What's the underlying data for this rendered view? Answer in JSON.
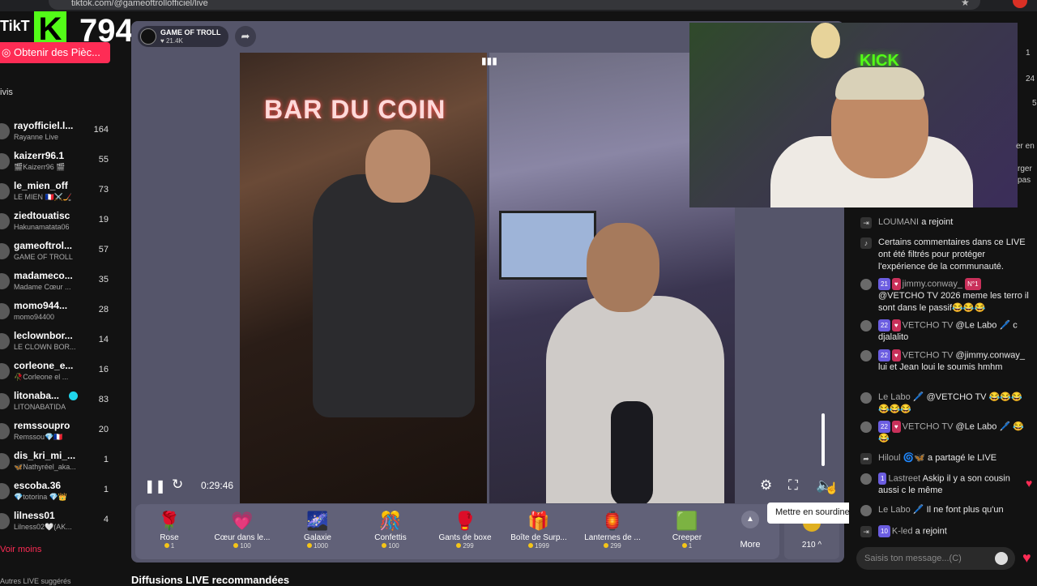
{
  "browser": {
    "url": "tiktok.com/@gameoftrollofficiel/live"
  },
  "overlay": {
    "tiktok_logo": "TikT",
    "viewer_count": "794"
  },
  "sidebar": {
    "coins_button": "Obtenir des Pièc...",
    "section_label": "ivis",
    "items": [
      {
        "name": "rayofficiel.l...",
        "sub": "Rayanne Live",
        "count": "164"
      },
      {
        "name": "kaizerr96.1",
        "sub": "🎬Kaizerr96 🎬",
        "count": "55"
      },
      {
        "name": "le_mien_off",
        "sub": "LE MIEN 🇫🇷⚔️🏒",
        "count": "73"
      },
      {
        "name": "ziedtouatisc",
        "sub": "Hakunamatata06",
        "count": "19"
      },
      {
        "name": "gameoftrol...",
        "sub": "GAME OF TROLL",
        "count": "57"
      },
      {
        "name": "madameco...",
        "sub": "Madame Cœur ...",
        "count": "35"
      },
      {
        "name": "momo944...",
        "sub": "momo94400",
        "count": "28"
      },
      {
        "name": "leclownbor...",
        "sub": "LE CLOWN BOR...",
        "count": "14"
      },
      {
        "name": "corleone_e...",
        "sub": "🥀Corleone el ...",
        "count": "16"
      },
      {
        "name": "litonaba...",
        "sub": "LITONABATIDA",
        "count": "83"
      },
      {
        "name": "remssoupro",
        "sub": "Remssou💎🇫🇷",
        "count": "20"
      },
      {
        "name": "dis_kri_mi_...",
        "sub": "🦋Nathyréel_aka...",
        "count": "1"
      },
      {
        "name": "escoba.36",
        "sub": "💎totorina 💎👑",
        "count": "1"
      },
      {
        "name": "lilness01",
        "sub": "Lilness02🤍(AK...",
        "count": "4"
      }
    ],
    "voir_moins": "Voir moins",
    "bottom_cut": "Autres LIVE suggérés"
  },
  "player": {
    "host_name": "GAME OF TROLL",
    "host_likes": "♥ 21.4K",
    "video_sign": "BAR DU COIN",
    "time": "0:29:46",
    "tooltip": "Mettre en sourdine (M)"
  },
  "gifts": [
    {
      "icon": "🌹",
      "name": "Rose",
      "price": "1"
    },
    {
      "icon": "💗",
      "name": "Cœur dans le...",
      "price": "100"
    },
    {
      "icon": "🌌",
      "name": "Galaxie",
      "price": "1000"
    },
    {
      "icon": "🎊",
      "name": "Confettis",
      "price": "100"
    },
    {
      "icon": "🥊",
      "name": "Gants de boxe",
      "price": "299"
    },
    {
      "icon": "🎁",
      "name": "Boîte de Surp...",
      "price": "1999"
    },
    {
      "icon": "🏮",
      "name": "Lanternes de ...",
      "price": "299"
    },
    {
      "icon": "🟩",
      "name": "Creeper",
      "price": "1"
    }
  ],
  "more_label": "More",
  "gift_counter": "210 ^",
  "recommended_title": "Diffusions LIVE recommandées",
  "webcam": {
    "sign": "KICK"
  },
  "edge": {
    "n1": "1",
    "n2": "24",
    "n3": "5",
    "t1": "er en",
    "t2": "rger",
    "t3": "pas"
  },
  "chat": [
    {
      "type": "system",
      "user": "LOUMANI",
      "text": "a rejoint"
    },
    {
      "type": "notice",
      "text": "Certains commentaires dans ce LIVE ont été filtrés pour protéger l'expérience de la communauté."
    },
    {
      "type": "msg",
      "level": "21",
      "fan": "♥",
      "user": "jimmy.conway_",
      "rank": "N°1",
      "text": "@VETCHO TV 2026 meme les terro il sont dans le passif😂😂😂"
    },
    {
      "type": "msg",
      "level": "22",
      "fan": "♥",
      "user": "VETCHO TV",
      "text": "@Le Labo 🖊️ c djalalito"
    },
    {
      "type": "msg",
      "level": "22",
      "fan": "♥",
      "user": "VETCHO TV",
      "text": "@jimmy.conway_ lui et Jean loui le soumis hmhm"
    },
    {
      "type": "msg",
      "level": "",
      "fan": "",
      "user": "Le Labo 🖊️",
      "text": "@VETCHO TV 😂😂😂😂😂😂"
    },
    {
      "type": "msg",
      "level": "22",
      "fan": "♥",
      "user": "VETCHO TV",
      "text": "@Le Labo 🖊️ 😂😂"
    },
    {
      "type": "share",
      "user": "Hiloul 🌀🦋",
      "text": "a partagé le LIVE"
    },
    {
      "type": "msg",
      "level": "1",
      "fan": "",
      "user": "Lastreet",
      "text": "Askip il y a son cousin aussi c le même"
    },
    {
      "type": "msg",
      "level": "",
      "fan": "",
      "user": "Le Labo 🖊️",
      "text": "Il ne font plus qu'un"
    },
    {
      "type": "system2",
      "level": "10",
      "user": "K-led",
      "text": "a rejoint"
    }
  ],
  "chat_input_placeholder": "Saisis ton message...(C)"
}
